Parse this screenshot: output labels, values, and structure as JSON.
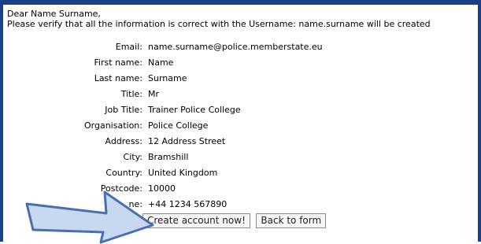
{
  "greeting": {
    "line1": "Dear Name Surname,",
    "line2": "Please verify that all the information is correct with the Username: name.surname will be created"
  },
  "details": [
    {
      "label": "Email:",
      "value": "name.surname@police.memberstate.eu"
    },
    {
      "label": "First name:",
      "value": "Name"
    },
    {
      "label": "Last name:",
      "value": "Surname"
    },
    {
      "label": "Title:",
      "value": "Mr"
    },
    {
      "label": "Job Title:",
      "value": "Trainer Police College"
    },
    {
      "label": "Organisation:",
      "value": "Police College"
    },
    {
      "label": "Address:",
      "value": "12 Address Street"
    },
    {
      "label": "City:",
      "value": "Bramshill"
    },
    {
      "label": "Country:",
      "value": "United Kingdom"
    },
    {
      "label": "Postcode:",
      "value": "10000"
    },
    {
      "label": "ne:",
      "value": "+44 1234 567890"
    }
  ],
  "buttons": {
    "create": "Create account now!",
    "back": "Back to form"
  },
  "colors": {
    "frame": "#1c3f87",
    "arrow_fill": "#c8d8f0",
    "arrow_stroke": "#4a6fb0"
  },
  "icons": {
    "callout_arrow": "right-arrow-icon"
  }
}
